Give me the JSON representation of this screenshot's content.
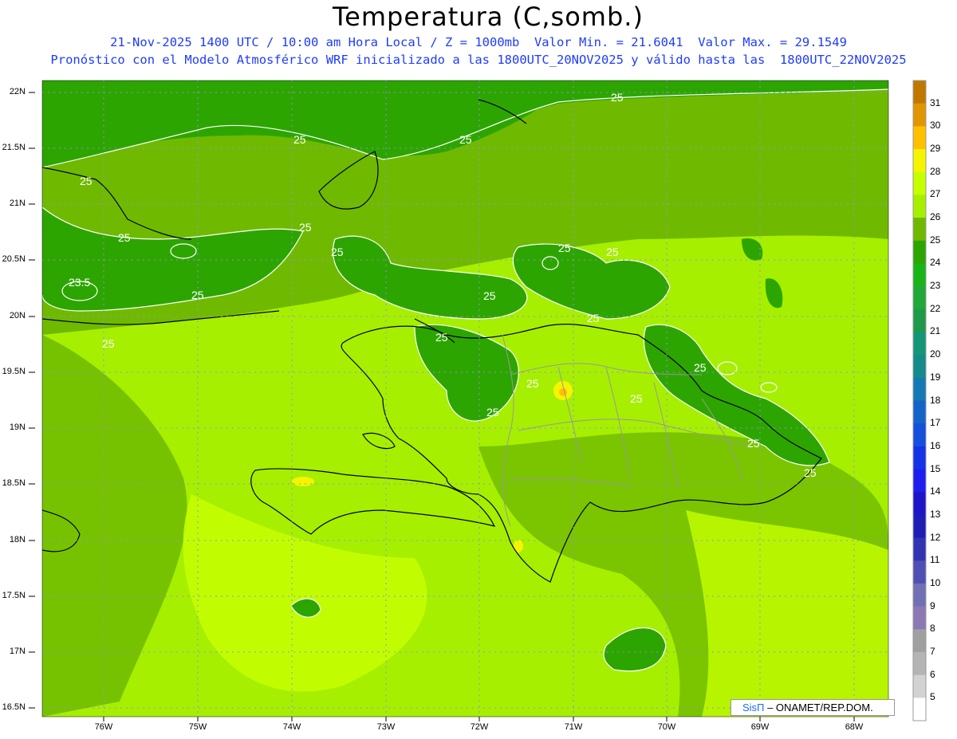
{
  "header": {
    "title": "Temperatura (C,somb.)",
    "line1": "21-Nov-2025 1400 UTC / 10:00 am Hora Local / Z = 1000mb  Valor Min. = 21.6041  Valor Max. = 29.1549",
    "line2": "Pronóstico con el Modelo Atmosférico WRF inicializado a las 1800UTC_20NOV2025 y válido hasta las  1800UTC_22NOV2025"
  },
  "axes": {
    "lat_labels": [
      "22N",
      "21.5N",
      "21N",
      "20.5N",
      "20N",
      "19.5N",
      "19N",
      "18.5N",
      "18N",
      "17.5N",
      "17N",
      "16.5N"
    ],
    "lon_labels": [
      "76W",
      "75W",
      "74W",
      "73W",
      "72W",
      "71W",
      "70W",
      "69W",
      "68W"
    ]
  },
  "colorbar": {
    "labels": [
      "31",
      "30",
      "29",
      "28",
      "27",
      "26",
      "25",
      "24",
      "23",
      "22",
      "21",
      "20",
      "19",
      "18",
      "17",
      "16",
      "15",
      "14",
      "13",
      "12",
      "11",
      "10",
      "9",
      "8",
      "7",
      "6",
      "5"
    ],
    "colors": [
      "#c07800",
      "#e09600",
      "#ffc000",
      "#f5f500",
      "#c6ff00",
      "#a6ef00",
      "#6fba00",
      "#2da500",
      "#18b418",
      "#20a838",
      "#1e9a4a",
      "#129678",
      "#148a8a",
      "#1478b4",
      "#1464c8",
      "#1450dc",
      "#1432e6",
      "#1e1ef0",
      "#1e14c8",
      "#1e1eb4",
      "#3232b4",
      "#5050b4",
      "#7070b4",
      "#8c78b4",
      "#a0a0a0",
      "#b4b4b4",
      "#d2d2d2",
      "#ffffff"
    ]
  },
  "contour_labels": [
    "25",
    "25",
    "25",
    "25",
    "25",
    "25",
    "25",
    "25",
    "23.5",
    "25",
    "25",
    "25",
    "25",
    "25",
    "25",
    "25",
    "25",
    "25",
    "25",
    "25",
    "25"
  ],
  "credit": {
    "brand": "SisΠ",
    "text": " – ONAMET/REP.DOM."
  }
}
